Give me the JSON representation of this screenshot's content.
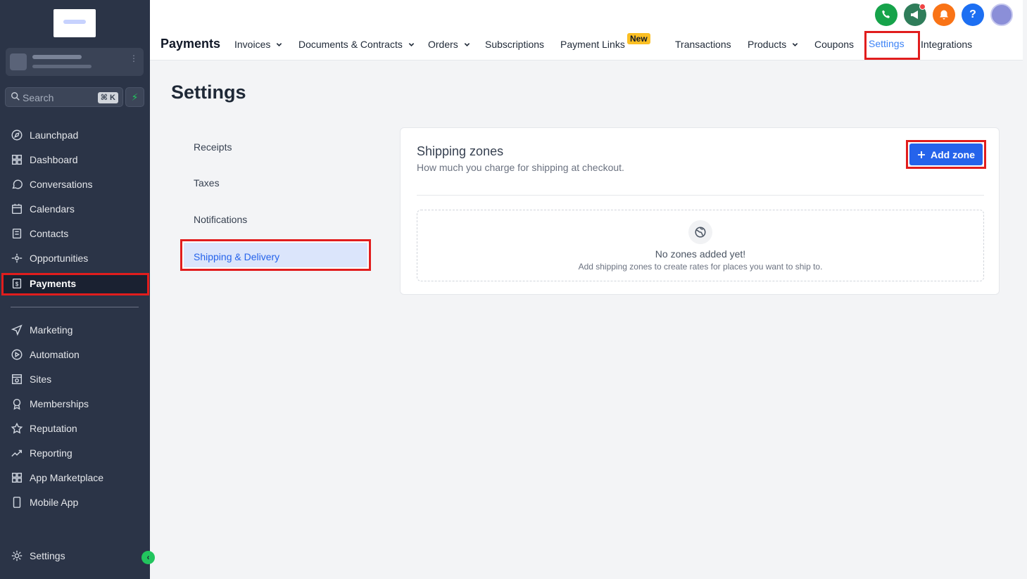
{
  "sidebar": {
    "search_placeholder": "Search",
    "search_shortcut": "⌘ K",
    "items": [
      {
        "label": "Launchpad",
        "icon": "rocket-icon"
      },
      {
        "label": "Dashboard",
        "icon": "grid-icon"
      },
      {
        "label": "Conversations",
        "icon": "chat-icon"
      },
      {
        "label": "Calendars",
        "icon": "calendar-icon"
      },
      {
        "label": "Contacts",
        "icon": "contacts-icon"
      },
      {
        "label": "Opportunities",
        "icon": "pipeline-icon"
      },
      {
        "label": "Payments",
        "icon": "payments-icon"
      },
      {
        "label": "Marketing",
        "icon": "send-icon"
      },
      {
        "label": "Automation",
        "icon": "automation-icon"
      },
      {
        "label": "Sites",
        "icon": "sites-icon"
      },
      {
        "label": "Memberships",
        "icon": "award-icon"
      },
      {
        "label": "Reputation",
        "icon": "star-icon"
      },
      {
        "label": "Reporting",
        "icon": "trend-icon"
      },
      {
        "label": "App Marketplace",
        "icon": "apps-icon"
      },
      {
        "label": "Mobile App",
        "icon": "phone-icon"
      },
      {
        "label": "Settings",
        "icon": "gear-icon"
      }
    ]
  },
  "topbar": {
    "title": "Payments",
    "tabs": [
      {
        "label": "Invoices"
      },
      {
        "label": "Documents & Contracts"
      },
      {
        "label": "Orders"
      },
      {
        "label": "Subscriptions"
      },
      {
        "label": "Payment Links"
      },
      {
        "label": "Transactions"
      },
      {
        "label": "Products"
      },
      {
        "label": "Coupons"
      },
      {
        "label": "Settings"
      },
      {
        "label": "Integrations"
      }
    ],
    "new_badge": "New",
    "help_label": "?",
    "icon_colors": {
      "phone": "#16a34a",
      "announce": "#2f7d5a",
      "bell": "#f97316",
      "help": "#1d6ff2",
      "avatar": "#8b8fd8"
    }
  },
  "main": {
    "title": "Settings",
    "subnav": [
      "Receipts",
      "Taxes",
      "Notifications",
      "Shipping & Delivery"
    ],
    "card": {
      "title": "Shipping zones",
      "subtitle": "How much you charge for shipping at checkout.",
      "add_button": "Add zone",
      "empty_title": "No zones added yet!",
      "empty_sub": "Add shipping zones to create rates for places you want to ship to."
    }
  },
  "colors": {
    "sidebar_bg": "#2b3447",
    "accent": "#2563eb",
    "highlight": "#e11d1d"
  }
}
